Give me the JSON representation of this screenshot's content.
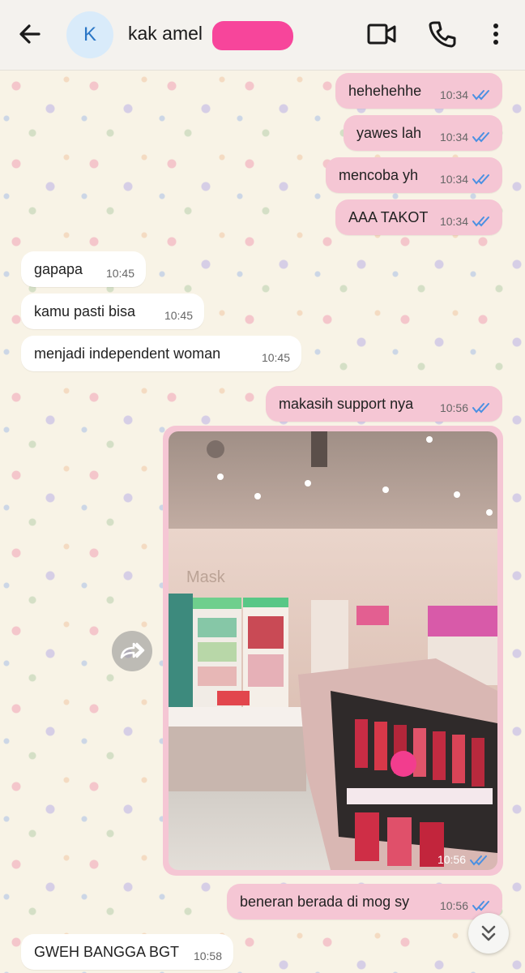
{
  "header": {
    "back_icon": "arrow-left-icon",
    "avatar_letter": "K",
    "contact_name": "kak amel",
    "video_icon": "video-camera-icon",
    "call_icon": "phone-icon",
    "more_icon": "more-vertical-icon"
  },
  "colors": {
    "outgoing_bubble": "#f5c6d4",
    "incoming_bubble": "#ffffff",
    "read_ticks": "#4a90e2",
    "redaction_mark": "#f7459b"
  },
  "messages": [
    {
      "direction": "out",
      "text": "hehehehhe",
      "time": "10:34",
      "status": "read"
    },
    {
      "direction": "out",
      "text": "yawes lah",
      "time": "10:34",
      "status": "read"
    },
    {
      "direction": "out",
      "text": "mencoba yh",
      "time": "10:34",
      "status": "read"
    },
    {
      "direction": "out",
      "text": "AAA TAKOT",
      "time": "10:34",
      "status": "read"
    },
    {
      "direction": "in",
      "text": "gapapa",
      "time": "10:45"
    },
    {
      "direction": "in",
      "text": "kamu pasti bisa",
      "time": "10:45"
    },
    {
      "direction": "in",
      "text": "menjadi independent woman",
      "time": "10:45"
    },
    {
      "direction": "out",
      "text": "makasih support nya",
      "time": "10:56",
      "status": "read"
    },
    {
      "direction": "out",
      "type": "image",
      "time": "10:56",
      "status": "read",
      "store_sign_text": "Mask"
    },
    {
      "direction": "out",
      "text": "beneran berada di mog sy",
      "time": "10:56",
      "status": "read"
    },
    {
      "direction": "in",
      "text": "GWEH BANGGA BGT",
      "time": "10:58"
    }
  ],
  "controls": {
    "forward_icon": "forward-icon",
    "scroll_down_icon": "double-chevron-down-icon"
  }
}
